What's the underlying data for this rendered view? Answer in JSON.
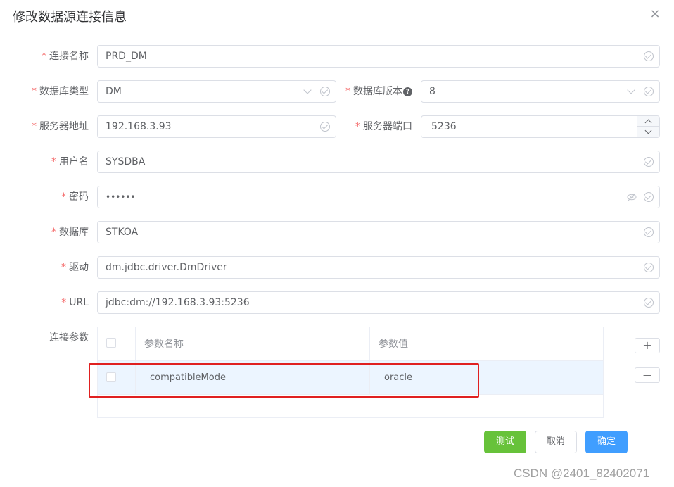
{
  "dialog": {
    "title": "修改数据源连接信息",
    "close_glyph": "×"
  },
  "form": {
    "required_mark": "*",
    "connection_name": {
      "label": "连接名称",
      "value": "PRD_DM"
    },
    "db_type": {
      "label": "数据库类型",
      "value": "DM"
    },
    "db_version": {
      "label": "数据库版本",
      "value": "8",
      "help_glyph": "?"
    },
    "server_address": {
      "label": "服务器地址",
      "value": "192.168.3.93"
    },
    "server_port": {
      "label": "服务器端口",
      "value": "5236"
    },
    "username": {
      "label": "用户名",
      "value": "SYSDBA"
    },
    "password": {
      "label": "密码",
      "value": "••••••"
    },
    "database": {
      "label": "数据库",
      "value": "STKOA"
    },
    "driver": {
      "label": "驱动",
      "value": "dm.jdbc.driver.DmDriver"
    },
    "url": {
      "label": "URL",
      "value": "jdbc:dm://192.168.3.93:5236"
    },
    "params": {
      "label": "连接参数",
      "headers": {
        "name": "参数名称",
        "value": "参数值"
      },
      "rows": [
        {
          "name": "compatibleMode",
          "value": "oracle"
        }
      ],
      "add_glyph": "+",
      "remove_glyph": "—"
    }
  },
  "buttons": {
    "test": "测试",
    "cancel": "取消",
    "ok": "确定"
  },
  "colors": {
    "primary": "#409eff",
    "success": "#67c23a",
    "required": "#f56c6c",
    "highlight": "#e02020",
    "selected_row": "#ecf5ff"
  },
  "watermark": "CSDN @2401_82402071"
}
